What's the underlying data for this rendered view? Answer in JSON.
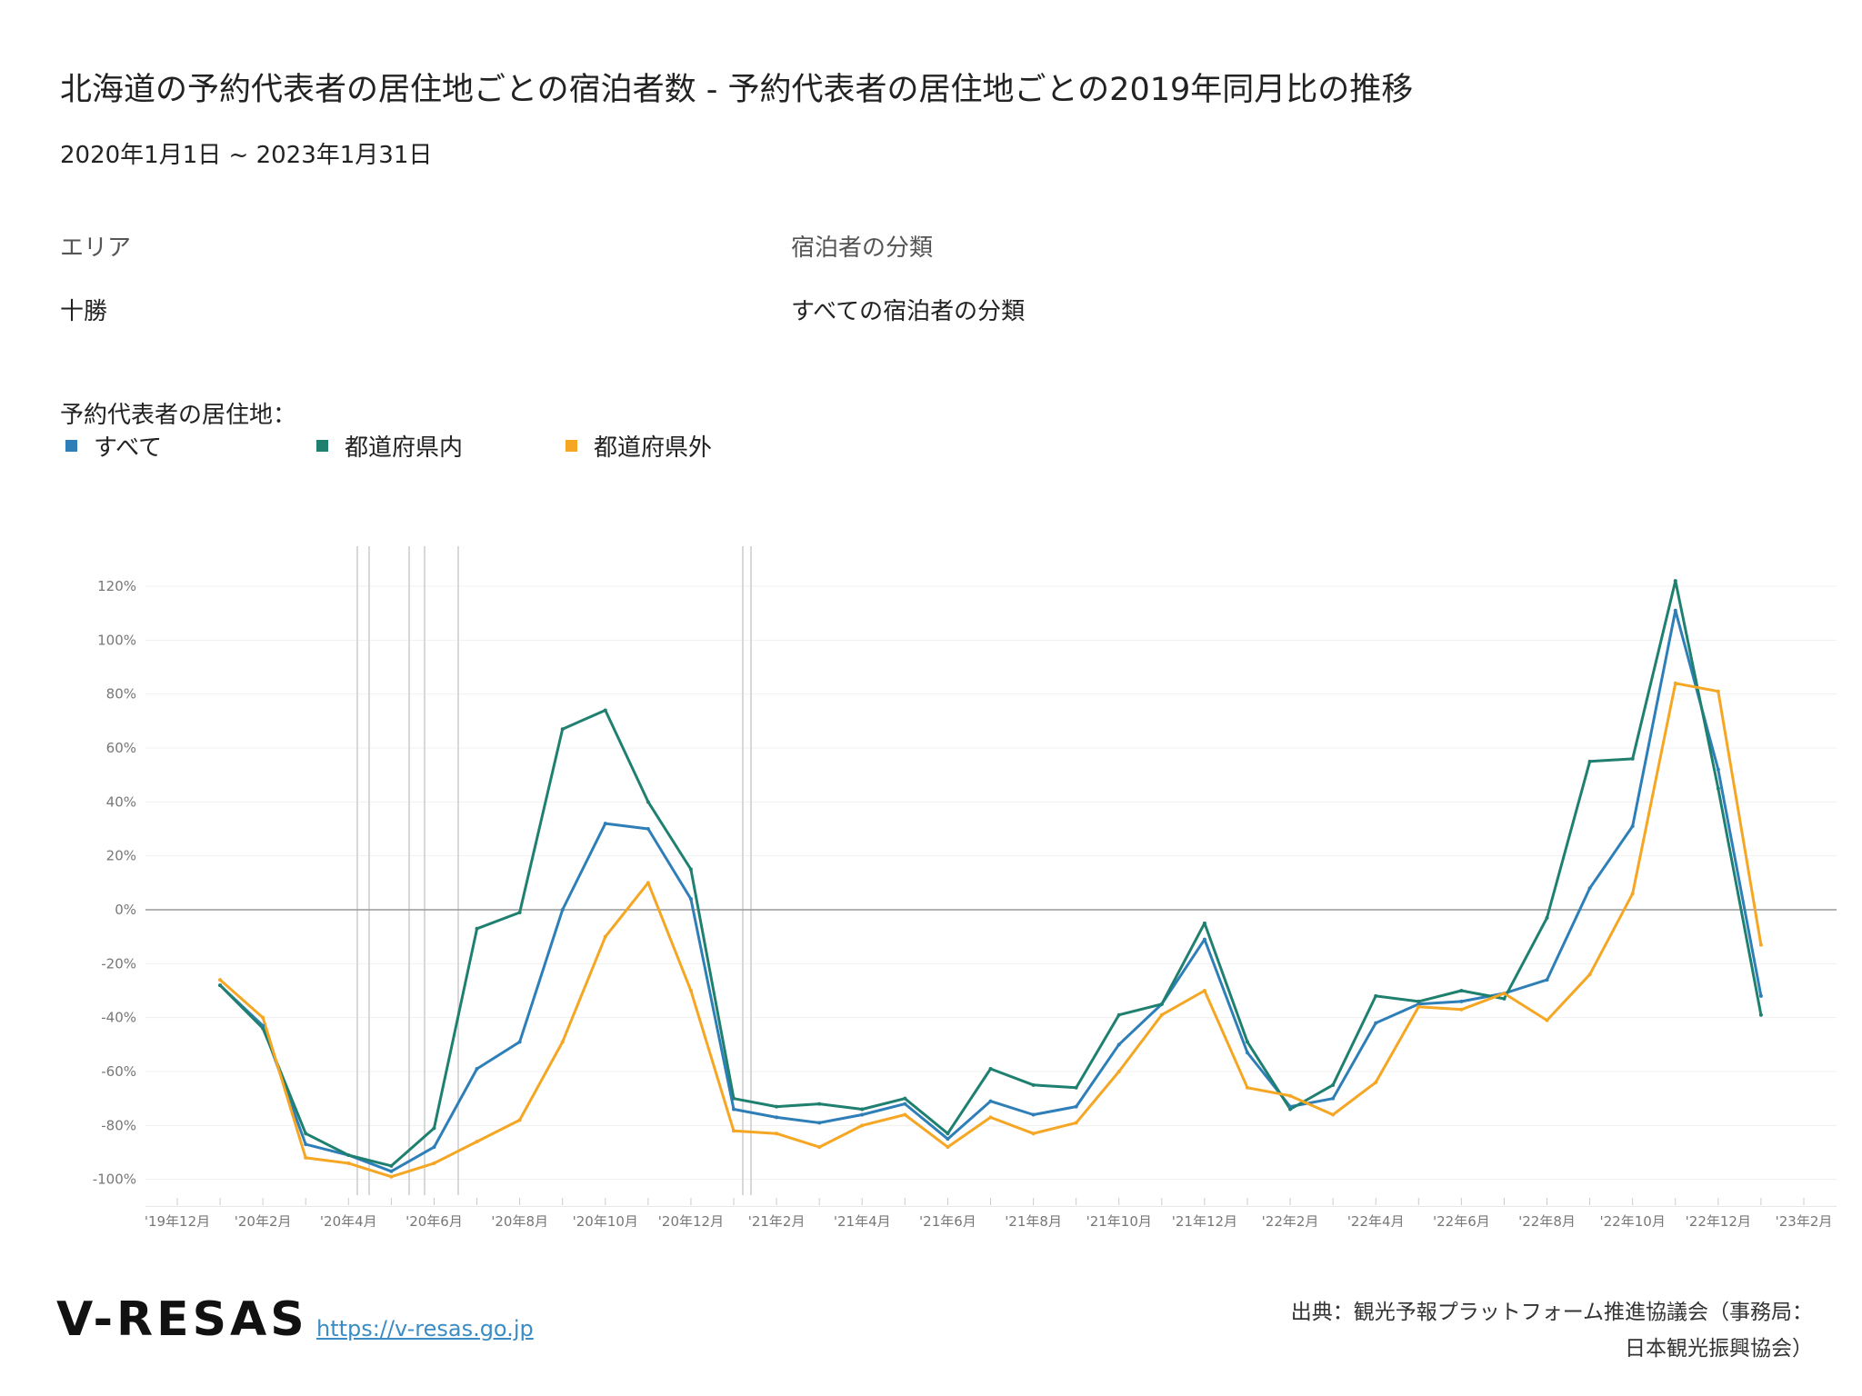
{
  "header": {
    "title": "北海道の予約代表者の居住地ごとの宿泊者数 - 予約代表者の居住地ごとの2019年同月比の推移",
    "period": "2020年1月1日 ~ 2023年1月31日"
  },
  "filters": {
    "area_label": "エリア",
    "area_value": "十勝",
    "category_label": "宿泊者の分類",
    "category_value": "すべての宿泊者の分類"
  },
  "legend": {
    "title": "予約代表者の居住地：",
    "items": [
      {
        "label": "すべて",
        "color": "#2e7fb8"
      },
      {
        "label": "都道府県内",
        "color": "#1f8070"
      },
      {
        "label": "都道府県外",
        "color": "#f5a623"
      }
    ]
  },
  "chart_data": {
    "type": "line",
    "y_unit": "%",
    "ylim": [
      -110,
      125
    ],
    "y_ticks": [
      120,
      100,
      80,
      60,
      40,
      20,
      0,
      -20,
      -40,
      -60,
      -80,
      -100
    ],
    "y_tick_labels": [
      "120%",
      "100%",
      "80%",
      "60%",
      "40%",
      "20%",
      "0%",
      "-20%",
      "-40%",
      "-60%",
      "-80%",
      "-100%"
    ],
    "x_tick_labels": [
      "'19年12月",
      "'20年2月",
      "'20年4月",
      "'20年6月",
      "'20年8月",
      "'20年10月",
      "'20年12月",
      "'21年2月",
      "'21年4月",
      "'21年6月",
      "'21年8月",
      "'21年10月",
      "'21年12月",
      "'22年2月",
      "'22年4月",
      "'22年6月",
      "'22年8月",
      "'22年10月",
      "'22年12月",
      "'23年2月"
    ],
    "x": [
      "2020-01",
      "2020-02",
      "2020-03",
      "2020-04",
      "2020-05",
      "2020-06",
      "2020-07",
      "2020-08",
      "2020-09",
      "2020-10",
      "2020-11",
      "2020-12",
      "2021-01",
      "2021-02",
      "2021-03",
      "2021-04",
      "2021-05",
      "2021-06",
      "2021-07",
      "2021-08",
      "2021-09",
      "2021-10",
      "2021-11",
      "2021-12",
      "2022-01",
      "2022-02",
      "2022-03",
      "2022-04",
      "2022-05",
      "2022-06",
      "2022-07",
      "2022-08",
      "2022-09",
      "2022-10",
      "2022-11",
      "2022-12",
      "2023-01"
    ],
    "series": [
      {
        "name": "すべて",
        "color": "#2e7fb8",
        "values": [
          -28,
          -43,
          -87,
          -91,
          -97,
          -88,
          -59,
          -49,
          0,
          32,
          30,
          4,
          -74,
          -77,
          -79,
          -76,
          -72,
          -85,
          -71,
          -76,
          -73,
          -50,
          -35,
          -11,
          -53,
          -73,
          -70,
          -42,
          -35,
          -34,
          -31,
          -26,
          8,
          31,
          111,
          52,
          -32
        ]
      },
      {
        "name": "都道府県内",
        "color": "#1f8070",
        "values": [
          -28,
          -44,
          -83,
          -91,
          -95,
          -81,
          -7,
          -1,
          67,
          74,
          40,
          15,
          -70,
          -73,
          -72,
          -74,
          -70,
          -83,
          -59,
          -65,
          -66,
          -39,
          -35,
          -5,
          -49,
          -74,
          -65,
          -32,
          -34,
          -30,
          -33,
          -3,
          55,
          56,
          122,
          45,
          -39
        ]
      },
      {
        "name": "都道府県外",
        "color": "#f5a623",
        "values": [
          -26,
          -40,
          -92,
          -94,
          -99,
          -94,
          -86,
          -78,
          -49,
          -10,
          10,
          -30,
          -82,
          -83,
          -88,
          -80,
          -76,
          -88,
          -77,
          -83,
          -79,
          -60,
          -39,
          -30,
          -66,
          -69,
          -76,
          -64,
          -36,
          -37,
          -31,
          -41,
          -24,
          6,
          84,
          81,
          -13
        ]
      }
    ],
    "grid": true
  },
  "footer": {
    "logo": "V-RESAS",
    "url": "https://v-resas.go.jp",
    "source_line1": "出典：観光予報プラットフォーム推進協議会（事務局：",
    "source_line2": "日本観光振興協会）"
  }
}
